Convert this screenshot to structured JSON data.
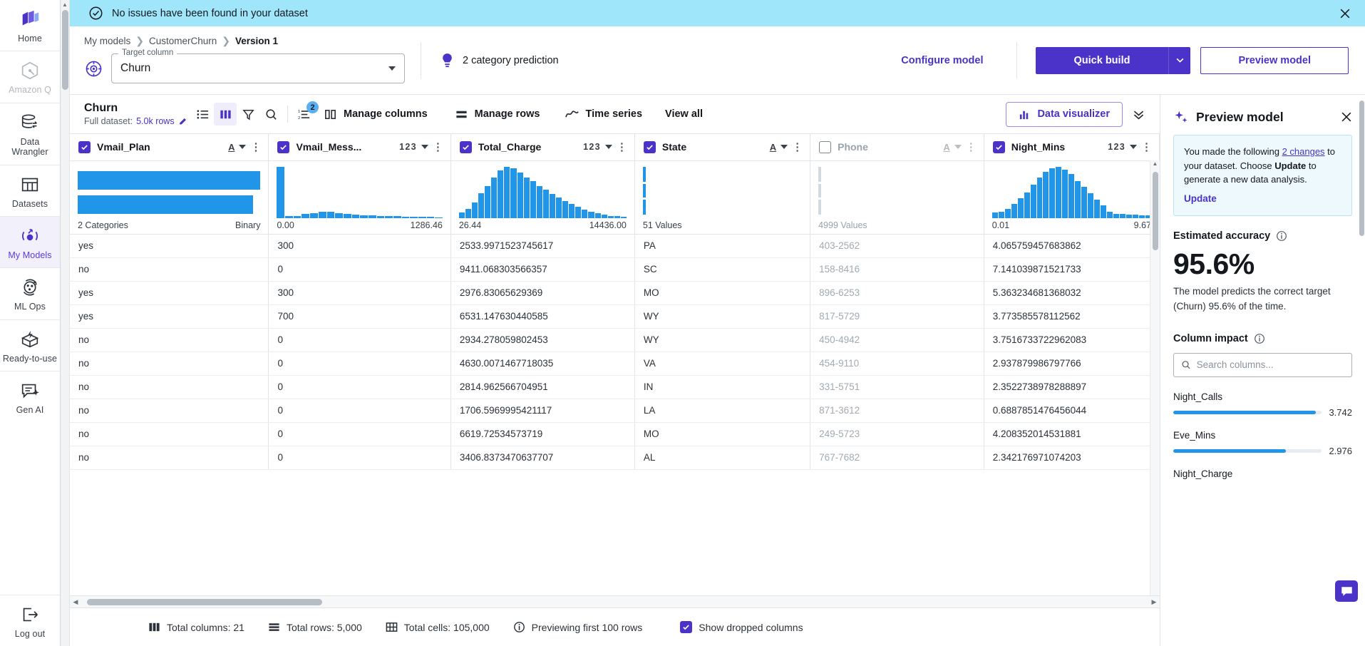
{
  "leftnav": {
    "items": [
      {
        "label": "Home",
        "icon": "home-icon",
        "state": "normal"
      },
      {
        "label": "Amazon Q",
        "icon": "amazon-q-icon",
        "state": "disabled"
      },
      {
        "label": "Data Wrangler",
        "icon": "data-wrangler-icon",
        "state": "normal"
      },
      {
        "label": "Datasets",
        "icon": "datasets-icon",
        "state": "normal"
      },
      {
        "label": "My Models",
        "icon": "my-models-icon",
        "state": "active"
      },
      {
        "label": "ML Ops",
        "icon": "ml-ops-icon",
        "state": "normal"
      },
      {
        "label": "Ready-to-use",
        "icon": "ready-to-use-icon",
        "state": "normal"
      },
      {
        "label": "Gen AI",
        "icon": "gen-ai-icon",
        "state": "normal"
      }
    ],
    "logout": {
      "label": "Log out",
      "icon": "logout-icon"
    }
  },
  "banner": {
    "message": "No issues have been found in your dataset",
    "icon": "check-circle-icon",
    "close_icon": "close-icon"
  },
  "header": {
    "breadcrumb": [
      {
        "label": "My models",
        "current": false
      },
      {
        "label": "CustomerChurn",
        "current": false
      },
      {
        "label": "Version 1",
        "current": true
      }
    ],
    "target_column": {
      "legend": "Target column",
      "value": "Churn",
      "icon": "target-icon"
    },
    "prediction_type": "2 category prediction",
    "prediction_icon": "lightbulb-icon",
    "configure_model": "Configure model",
    "quick_build": "Quick build",
    "quick_build_arrow_icon": "chevron-down-icon",
    "preview_model": "Preview model"
  },
  "toolbar": {
    "title": "Churn",
    "subtitle_label": "Full dataset:",
    "subtitle_value": "5.0k rows",
    "edit_icon": "pencil-icon",
    "icons": [
      {
        "name": "list-view-icon",
        "selected": false
      },
      {
        "name": "column-view-icon",
        "selected": true
      },
      {
        "name": "filter-icon",
        "selected": false
      },
      {
        "name": "search-icon",
        "selected": false
      },
      {
        "name": "sort-icon",
        "selected": false,
        "badge": "2"
      }
    ],
    "manage_columns": {
      "label": "Manage columns",
      "icon": "columns-icon"
    },
    "manage_rows": {
      "label": "Manage rows",
      "icon": "rows-icon"
    },
    "time_series": {
      "label": "Time series",
      "icon": "timeseries-icon"
    },
    "view_all": "View all",
    "data_visualizer": {
      "label": "Data visualizer",
      "icon": "bar-chart-icon"
    },
    "collapse_icon": "double-chevron-down-icon"
  },
  "table": {
    "columns": [
      {
        "name": "Vmail_Plan",
        "type": "A",
        "checked": true,
        "dropped": false,
        "hist_type": "categorical",
        "stat_left": "2 Categories",
        "stat_right": "Binary",
        "cat_bars": [
          100,
          96
        ]
      },
      {
        "name": "Vmail_Mess...",
        "type": "123",
        "checked": true,
        "dropped": false,
        "hist_type": "numeric",
        "stat_left": "0.00",
        "stat_right": "1286.46",
        "bars": [
          100,
          4,
          3,
          8,
          9,
          12,
          12,
          9,
          8,
          6,
          5,
          5,
          4,
          3,
          3,
          2,
          2,
          2,
          2,
          1
        ]
      },
      {
        "name": "Total_Charge",
        "type": "123",
        "checked": true,
        "dropped": false,
        "hist_type": "numeric",
        "stat_left": "26.44",
        "stat_right": "14436.00",
        "bars": [
          10,
          17,
          30,
          48,
          62,
          78,
          92,
          100,
          96,
          88,
          79,
          72,
          62,
          55,
          47,
          40,
          33,
          27,
          21,
          16,
          12,
          9,
          6,
          4,
          3,
          2
        ]
      },
      {
        "name": "State",
        "type": "A",
        "checked": true,
        "dropped": false,
        "hist_type": "sparse",
        "stat_left": "51 Values",
        "stat_right": "",
        "sparse_color": "#2196e8"
      },
      {
        "name": "Phone",
        "type": "A",
        "checked": false,
        "dropped": true,
        "hist_type": "sparse",
        "stat_left": "4999 Values",
        "stat_right": "",
        "sparse_color": "#d4d9dd"
      },
      {
        "name": "Night_Mins",
        "type": "123",
        "checked": true,
        "dropped": false,
        "hist_type": "numeric",
        "stat_left": "0.01",
        "stat_right": "9.67",
        "bars": [
          10,
          12,
          18,
          27,
          38,
          50,
          64,
          78,
          90,
          97,
          100,
          94,
          86,
          72,
          60,
          48,
          36,
          24,
          12,
          8,
          7,
          6,
          6,
          5,
          5
        ]
      }
    ],
    "rows": [
      [
        "yes",
        "300",
        "2533.9971523745617",
        "PA",
        "403-2562",
        "4.065759457683862"
      ],
      [
        "no",
        "0",
        "9411.068303566357",
        "SC",
        "158-8416",
        "7.141039871521733"
      ],
      [
        "yes",
        "300",
        "2976.83065629369",
        "MO",
        "896-6253",
        "5.363234681368032"
      ],
      [
        "yes",
        "700",
        "6531.147630440585",
        "WY",
        "817-5729",
        "3.773585578112562"
      ],
      [
        "no",
        "0",
        "2934.278059802453",
        "WY",
        "450-4942",
        "3.7516733722962083"
      ],
      [
        "no",
        "0",
        "4630.0071467718035",
        "VA",
        "454-9110",
        "2.937879986797766"
      ],
      [
        "no",
        "0",
        "2814.962566704951",
        "IN",
        "331-5751",
        "2.3522738978288897"
      ],
      [
        "no",
        "0",
        "1706.5969995421117",
        "LA",
        "871-3612",
        "0.6887851476456044"
      ],
      [
        "no",
        "0",
        "6619.72534573719",
        "MO",
        "249-5723",
        "4.208352014531881"
      ],
      [
        "no",
        "0",
        "3406.8373470637707",
        "AL",
        "767-7682",
        "2.342176971074203"
      ]
    ]
  },
  "footer": {
    "total_columns": "Total columns: 21",
    "total_rows": "Total rows: 5,000",
    "total_cells": "Total cells: 105,000",
    "previewing": "Previewing first 100 rows",
    "show_dropped": "Show dropped columns",
    "show_dropped_checked": true
  },
  "preview_panel": {
    "title": "Preview model",
    "title_icon": "sparkle-icon",
    "close_icon": "close-icon",
    "notice": {
      "text_before": "You made the following ",
      "link": "2 changes",
      "text_mid": " to your dataset. Choose ",
      "strong": "Update",
      "text_after": " to generate a new data analysis.",
      "action": "Update"
    },
    "estimated_accuracy_label": "Estimated accuracy",
    "accuracy_value": "95.6%",
    "accuracy_desc": "The model predicts the correct target (Churn) 95.6% of the time.",
    "column_impact_label": "Column impact",
    "info_icon": "info-icon",
    "search_placeholder": "Search columns...",
    "search_value": "",
    "search_icon": "search-icon",
    "impacts": [
      {
        "name": "Night_Calls",
        "value": "3.742",
        "pct": 96
      },
      {
        "name": "Eve_Mins",
        "value": "2.976",
        "pct": 76
      },
      {
        "name": "Night_Charge",
        "value": "",
        "pct": 0
      }
    ]
  },
  "chat": {
    "icon": "chat-icon"
  },
  "colors": {
    "accent": "#4b32c8",
    "link": "#4733c4",
    "bar": "#2196e8",
    "banner": "#9fe6fb",
    "notice_bg": "#eef9fd"
  }
}
